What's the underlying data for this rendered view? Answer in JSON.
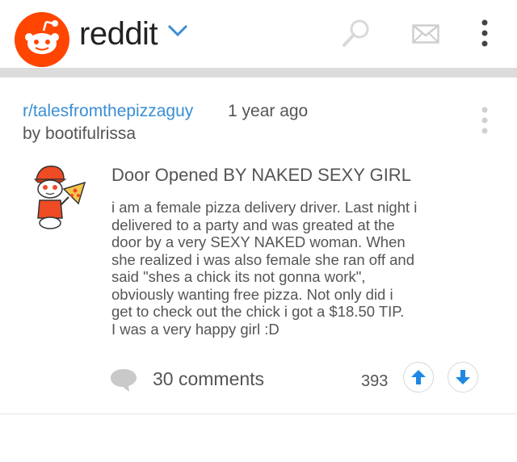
{
  "header": {
    "brand": "reddit",
    "accent_color": "#ff4500",
    "icons": [
      "reddit-alien-logo",
      "chevron-down-icon",
      "search-icon",
      "mail-icon",
      "more-vertical-icon"
    ]
  },
  "post": {
    "subreddit": "r/talesfromthepizzaguy",
    "time": "1 year ago",
    "author": "by bootifulrissa",
    "title": "Door Opened BY NAKED SEXY GIRL",
    "body": "i am a female pizza delivery driver. Last night i\ndelivered to a party and was greated at the\ndoor by a very SEXY NAKED woman. When\nshe realized i was also female she ran off and\nsaid \"shes a chick its not gonna work\",\nobviously wanting free pizza. Not only did i\nget to check out the chick i got a $18.50 TIP.\nI was a very happy girl :D",
    "comments": "30 comments",
    "score": "393",
    "link_color": "#3a8ed4",
    "vote_color": "#1e88e5"
  }
}
